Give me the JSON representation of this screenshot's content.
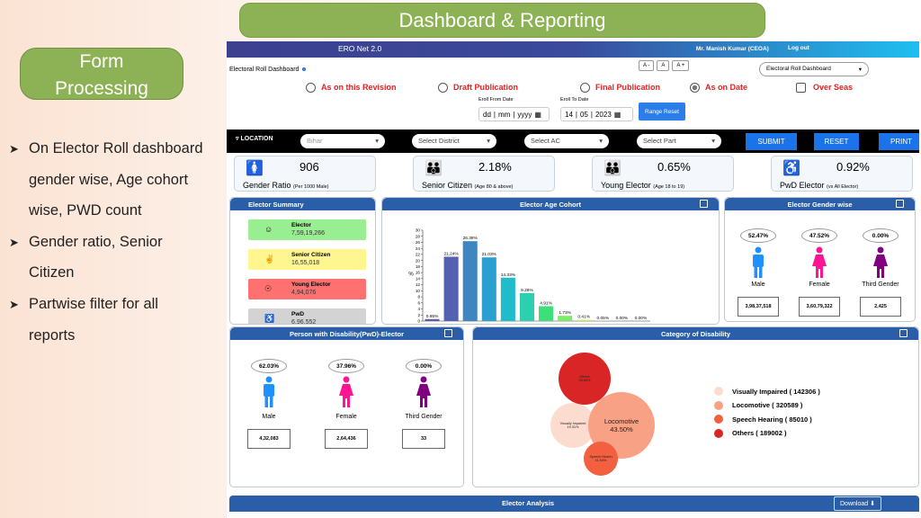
{
  "slide": {
    "title": "Dashboard & Reporting",
    "section_line1": "Form",
    "section_line2": "Processing",
    "bullets": [
      {
        "text": "On Elector Roll dashboard",
        "cont": [
          "gender wise, Age cohort",
          "wise, PWD count"
        ]
      },
      {
        "text": "Gender ratio, Senior",
        "cont": [
          "Citizen"
        ]
      },
      {
        "text": "Partwise filter for all",
        "cont": [
          "reports"
        ]
      }
    ]
  },
  "app": {
    "name": "ERO Net 2.0",
    "user": "Mr. Manish Kumar (CEOA)",
    "logout": "Log out",
    "page_title": "Electoral Roll Dashboard",
    "font_buttons": [
      "A -",
      "A",
      "A +"
    ],
    "dashboard_select": "Electoral Roll Dashboard",
    "options": [
      {
        "label": "As on this Revision",
        "selected": false
      },
      {
        "label": "Draft Publication",
        "selected": false
      },
      {
        "label": "Final Publication",
        "selected": false
      },
      {
        "label": "As on Date",
        "selected": true
      }
    ],
    "overseas": {
      "label": "Over Seas",
      "checked": false
    },
    "from_date": {
      "label": "Eroll From Date",
      "dd": "dd",
      "mm": "mm",
      "yyyy": "yyyy"
    },
    "to_date": {
      "label": "Eroll To Date",
      "dd": "14",
      "mm": "05",
      "yyyy": "2023"
    },
    "range_reset": "Range Reset"
  },
  "filters": {
    "label": "LOCATION",
    "state": "Bihar",
    "district": "Select District",
    "ac": "Select AC",
    "part": "Select Part",
    "submit": "SUBMIT",
    "reset": "RESET",
    "print": "PRINT"
  },
  "kpis": [
    {
      "value": "906",
      "label": "Gender Ratio",
      "sub": "(Per 1000 Male)"
    },
    {
      "value": "2.18%",
      "label": "Senior Citizen",
      "sub": "(Age 80 & above)"
    },
    {
      "value": "0.65%",
      "label": "Young Elector",
      "sub": "(Age 18 to 19)"
    },
    {
      "value": "0.92%",
      "label": "PwD Elector",
      "sub": "(vs All Elector)"
    }
  ],
  "summary": {
    "title": "Elector Summary",
    "items": [
      {
        "label": "Elector",
        "value": "7,59,19,266",
        "color": "#98ee90"
      },
      {
        "label": "Senior Citizen",
        "value": "16,55,018",
        "color": "#fff68f"
      },
      {
        "label": "Young Elector",
        "value": "4,94,076",
        "color": "#ff7070"
      },
      {
        "label": "PwD",
        "value": "6,96,552",
        "color": "#d3d3d3"
      }
    ]
  },
  "chart_data": {
    "type": "bar",
    "title": "Elector Age Cohort",
    "xlabel": "Age Cohort",
    "ylabel": "%",
    "ylim": [
      0,
      30
    ],
    "yticks": [
      0,
      2,
      4,
      6,
      8,
      10,
      12,
      14,
      16,
      18,
      20,
      22,
      24,
      26,
      28,
      30
    ],
    "categories": [
      "18-19",
      "20-29",
      "30-39",
      "40-49",
      "50-59",
      "60-69",
      "70-79",
      "80-89",
      "90-99",
      "100-109",
      "110-119",
      "120+"
    ],
    "values": [
      0.65,
      21.24,
      26.38,
      21.03,
      14.33,
      9.26,
      4.91,
      1.73,
      0.41,
      0.05,
      0.0,
      0.0
    ],
    "labels": [
      "0.65%",
      "21.24%",
      "26.38%",
      "21.03%",
      "14.33%",
      "9.26%",
      "4.91%",
      "1.73%",
      "0.41%",
      "0.05%",
      "0.00%",
      "0.00%"
    ],
    "colors": [
      "#5b5ea6",
      "#5560b0",
      "#3f85bf",
      "#2b9fcf",
      "#20bccc",
      "#2ccfae",
      "#3ede7a",
      "#7eea6a",
      "#bdf06c",
      "#d8f275",
      "#e6f47d",
      "#eef585"
    ]
  },
  "gender": {
    "title": "Elector Gender wise",
    "items": [
      {
        "pct": "52.47%",
        "label": "Male",
        "count": "3,98,37,518",
        "color": "#1e90ff"
      },
      {
        "pct": "47.52%",
        "label": "Female",
        "count": "3,60,79,322",
        "color": "#ff1493"
      },
      {
        "pct": "0.00%",
        "label": "Third Gender",
        "count": "2,425",
        "color": "#800080"
      }
    ]
  },
  "pwd": {
    "title": "Person with Disability(PwD)-Elector",
    "items": [
      {
        "pct": "62.03%",
        "label": "Male",
        "count": "4,32,083",
        "color": "#1e90ff"
      },
      {
        "pct": "37.96%",
        "label": "Female",
        "count": "2,64,436",
        "color": "#ff1493"
      },
      {
        "pct": "0.00%",
        "label": "Third Gender",
        "count": "33",
        "color": "#800080"
      }
    ]
  },
  "disability": {
    "title": "Category of Disability",
    "items": [
      {
        "name": "Visually Impaired",
        "count": "142306",
        "pct": "19.31%",
        "bubble": "Visually Impaired",
        "color": "#fddcd0"
      },
      {
        "name": "Locomotive",
        "count": "320589",
        "pct": "43.50%",
        "bubble": "Locomotive",
        "color": "#f9a184"
      },
      {
        "name": "Speech Hearing",
        "count": "85010",
        "pct": "11.54%",
        "bubble": "Speech Hearin",
        "color": "#f2603f"
      },
      {
        "name": "Others",
        "count": "189002",
        "pct": "25.65%",
        "bubble": "Others",
        "color": "#d92525"
      }
    ]
  },
  "analysis": {
    "title": "Elector Analysis",
    "download": "Download"
  }
}
